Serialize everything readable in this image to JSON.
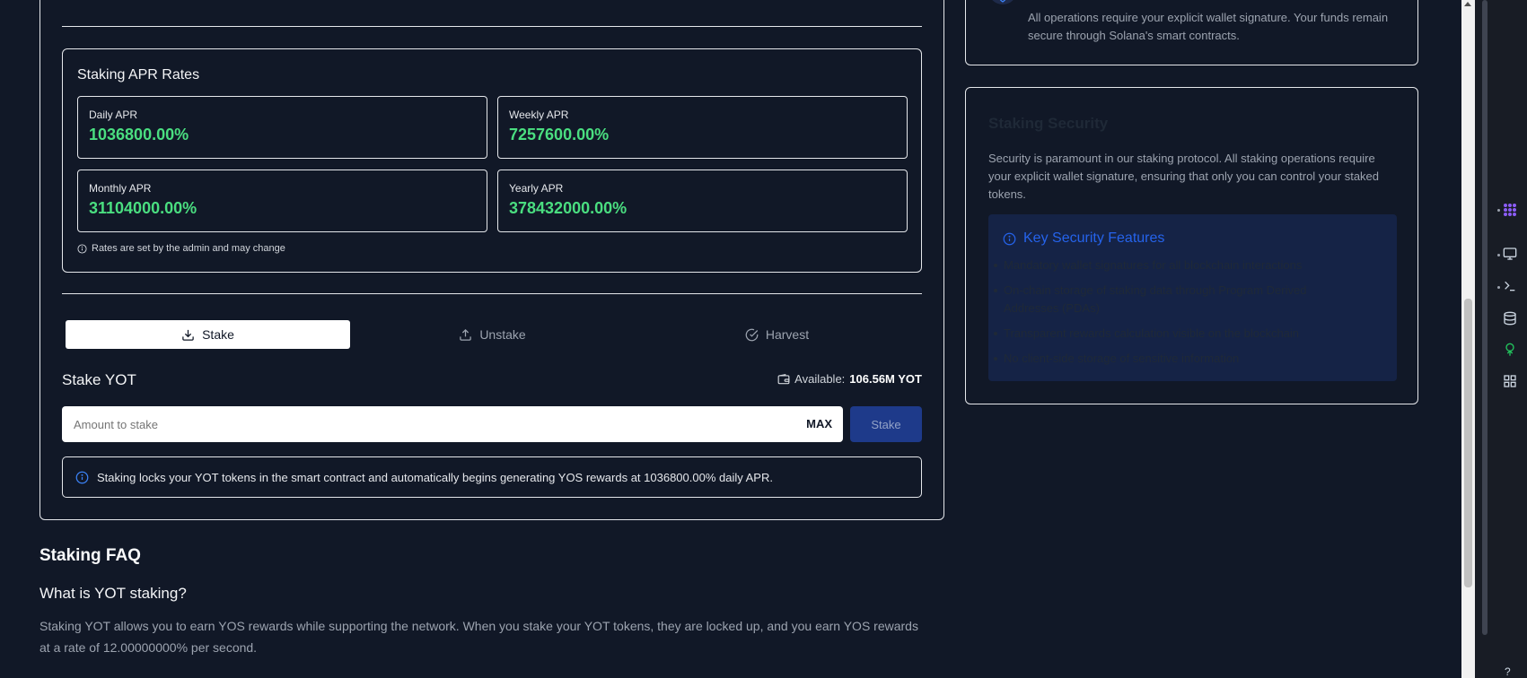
{
  "apr": {
    "title": "Staking APR Rates",
    "daily": {
      "label": "Daily APR",
      "value": "1036800.00%"
    },
    "weekly": {
      "label": "Weekly APR",
      "value": "7257600.00%"
    },
    "monthly": {
      "label": "Monthly APR",
      "value": "31104000.00%"
    },
    "yearly": {
      "label": "Yearly APR",
      "value": "378432000.00%"
    },
    "note": "Rates are set by the admin and may change"
  },
  "tabs": {
    "stake": "Stake",
    "unstake": "Unstake",
    "harvest": "Harvest"
  },
  "stake_form": {
    "title": "Stake YOT",
    "available_label": "Available:",
    "available_value": "106.56M YOT",
    "placeholder": "Amount to stake",
    "max_label": "MAX",
    "submit_label": "Stake",
    "info": "Staking locks your YOT tokens in the smart contract and automatically begins generating YOS rewards at 1036800.00% daily APR."
  },
  "faq": {
    "title": "Staking FAQ",
    "q1": "What is YOT staking?",
    "a1": "Staking YOT allows you to earn YOS rewards while supporting the network. When you stake your YOT tokens, they are locked up, and you earn YOS rewards at a rate of 12.00000000% per second."
  },
  "wallet_card": {
    "text": "All operations require your explicit wallet signature. Your funds remain secure through Solana's smart contracts."
  },
  "security": {
    "title": "Staking Security",
    "description": "Security is paramount in our staking protocol. All staking operations require your explicit wallet signature, ensuring that only you can control your staked tokens.",
    "features_title": "Key Security Features",
    "features": [
      "Mandatory wallet signatures for all blockchain interactions",
      "On-chain storage of staking data through Program Derived Addresses (PDAs)",
      "Transparent rewards calculation visible on the blockchain",
      "No client-side storage of sensitive information"
    ]
  },
  "colors": {
    "background": "#111827",
    "apr_green": "#4ade80",
    "accent_blue": "#2563eb",
    "stake_button": "#1e3a8a"
  }
}
